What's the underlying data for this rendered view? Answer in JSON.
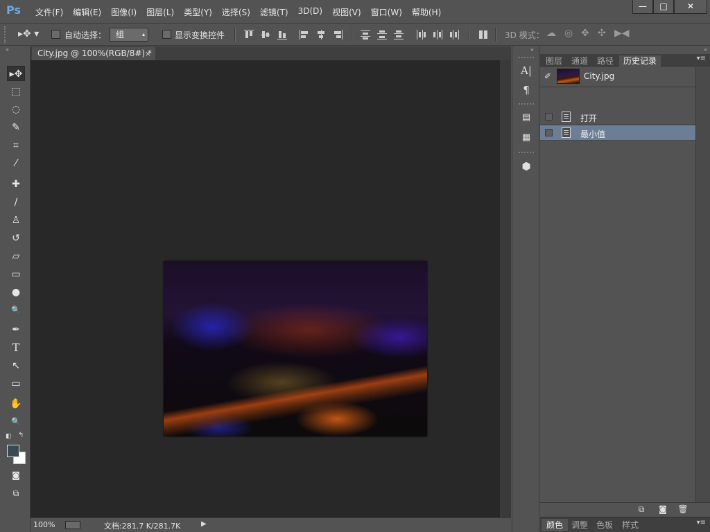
{
  "app": {
    "logo": "Ps"
  },
  "menubar": {
    "items": [
      "文件(F)",
      "编辑(E)",
      "图像(I)",
      "图层(L)",
      "类型(Y)",
      "选择(S)",
      "滤镜(T)",
      "3D(D)",
      "视图(V)",
      "窗口(W)",
      "帮助(H)"
    ]
  },
  "window_controls": {
    "minimize": "—",
    "maximize": "□",
    "close": "✕"
  },
  "options_bar": {
    "tool_preset_icon": "move-tool-icon",
    "tool_preset_glyph": "▸✥ ▾",
    "auto_select_label": "自动选择：",
    "auto_select_value": "组",
    "show_transform_label": "显示变换控件",
    "mode_3d_label": "3D 模式："
  },
  "toolbox": {
    "collapse": "»",
    "tools": [
      {
        "name": "move-tool",
        "glyph": "▸✥"
      },
      {
        "name": "marquee-tool",
        "glyph": "⬚"
      },
      {
        "name": "lasso-tool",
        "glyph": "◌"
      },
      {
        "name": "quick-select-tool",
        "glyph": "✎"
      },
      {
        "name": "crop-tool",
        "glyph": "⌗"
      },
      {
        "name": "eyedropper-tool",
        "glyph": "⁄"
      },
      {
        "name": "healing-brush-tool",
        "glyph": "✚"
      },
      {
        "name": "brush-tool",
        "glyph": "∕"
      },
      {
        "name": "clone-stamp-tool",
        "glyph": "♙"
      },
      {
        "name": "history-brush-tool",
        "glyph": "↺"
      },
      {
        "name": "eraser-tool",
        "glyph": "▱"
      },
      {
        "name": "gradient-tool",
        "glyph": "▭"
      },
      {
        "name": "blur-tool",
        "glyph": "●"
      },
      {
        "name": "dodge-tool",
        "glyph": "🔍"
      },
      {
        "name": "pen-tool",
        "glyph": "✒"
      },
      {
        "name": "type-tool",
        "glyph": "T"
      },
      {
        "name": "path-select-tool",
        "glyph": "↖"
      },
      {
        "name": "shape-tool",
        "glyph": "▭"
      },
      {
        "name": "hand-tool",
        "glyph": "✋"
      },
      {
        "name": "zoom-tool",
        "glyph": "🔍"
      }
    ],
    "colors": {
      "foreground": "#384a52",
      "background": "#ffffff"
    }
  },
  "document": {
    "tab_title": "City.jpg @ 100%(RGB/8#) *",
    "tab_close": "×"
  },
  "statusbar": {
    "zoom": "100%",
    "doc_info": "文档:281.7 K/281.7K",
    "arrow": "▶"
  },
  "dock": {
    "collapse": "«"
  },
  "history_panel": {
    "tabs": [
      "图层",
      "通道",
      "路径",
      "历史记录"
    ],
    "active_tab": 3,
    "menu": "▾≡",
    "collapse": "«",
    "snapshot": {
      "name": "City.jpg"
    },
    "rows": [
      {
        "label": "打开",
        "selected": false
      },
      {
        "label": "最小值",
        "selected": true
      }
    ]
  },
  "bottom_panel": {
    "tabs": [
      "颜色",
      "调整",
      "色板",
      "样式"
    ],
    "active_tab": 0,
    "menu": "▾≡"
  },
  "colors": {
    "selection": "#6c7d96",
    "canvas_bg": "#282828",
    "ui_bg": "#535353"
  }
}
